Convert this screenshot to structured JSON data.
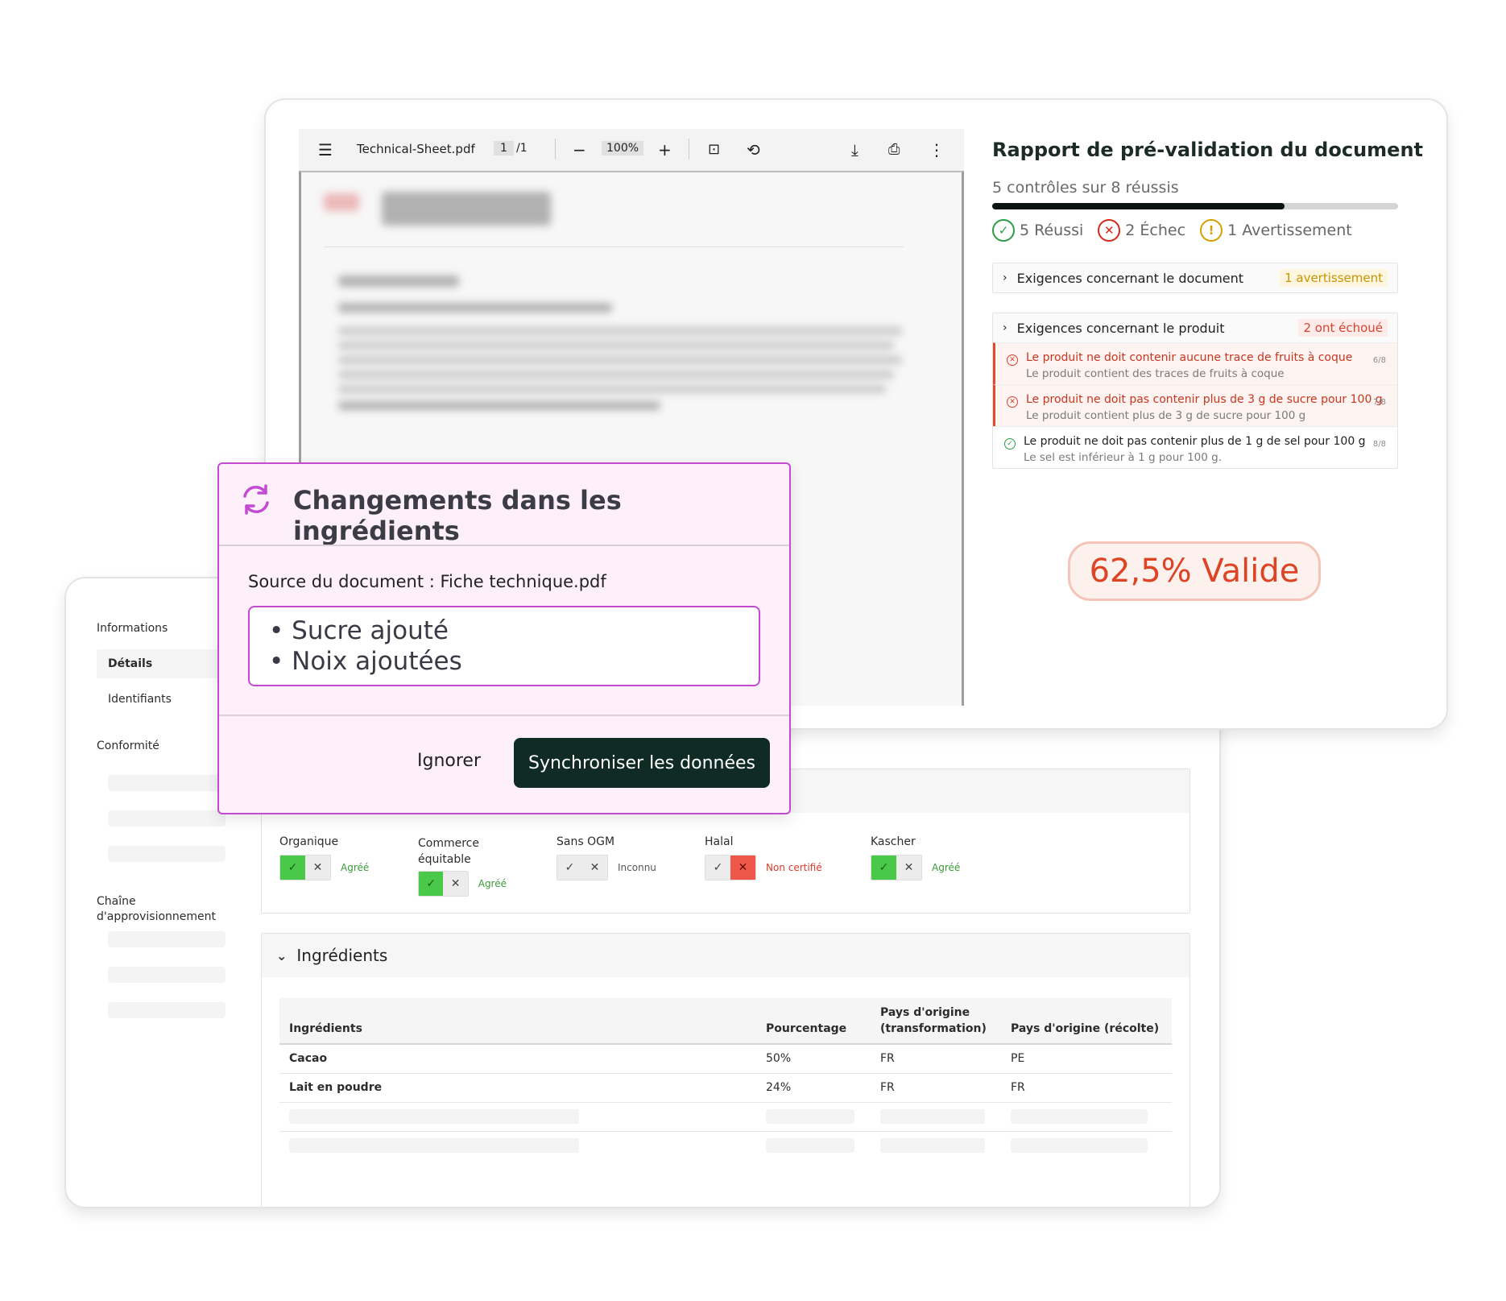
{
  "product_form": {
    "nav": {
      "section_info": "Informations",
      "item_details": "Détails",
      "item_ids": "Identifiants",
      "section_compliance": "Conformité",
      "section_supply": "Chaîne d'approvisionnement"
    },
    "certifications": [
      {
        "label": "Organique",
        "state": "yes",
        "status": "Agréé"
      },
      {
        "label": "Commerce équitable",
        "state": "yes",
        "status": "Agréé"
      },
      {
        "label": "Sans OGM",
        "state": "none",
        "status": "Inconnu"
      },
      {
        "label": "Halal",
        "state": "no",
        "status": "Non certifié"
      },
      {
        "label": "Kascher",
        "state": "yes",
        "status": "Agréé"
      }
    ],
    "ingredients_section": {
      "title": "Ingrédients",
      "columns": [
        "Ingrédients",
        "Pourcentage",
        "Pays d'origine (transformation)",
        "Pays d'origine (récolte)"
      ],
      "rows": [
        [
          "Cacao",
          "50%",
          "FR",
          "PE"
        ],
        [
          "Lait en poudre",
          "24%",
          "FR",
          "FR"
        ]
      ]
    }
  },
  "pdf_viewer": {
    "filename": "Technical-Sheet.pdf",
    "page_current": "1",
    "page_total": "/1",
    "zoom": "100%"
  },
  "report": {
    "title": "Rapport de pré-validation du document",
    "summary": "5 contrôles sur 8 réussis",
    "progress_fraction": 0.72,
    "passed": "5 Réussi",
    "failed": "2 Échec",
    "warning": "1 Avertissement",
    "doc_requirements": {
      "label": "Exigences concernant le document",
      "badge": "1 avertissement"
    },
    "product_requirements": {
      "label": "Exigences concernant le produit",
      "badge": "2 ont échoué",
      "items": [
        {
          "result": "fail",
          "title": "Le produit ne doit contenir aucune trace de fruits à coque",
          "detail": "Le produit contient des traces de fruits à coque",
          "index": "6/8"
        },
        {
          "result": "fail",
          "title": "Le produit ne doit pas contenir plus de 3 g de sucre pour 100 g",
          "detail": "Le produit contient plus de 3 g de sucre pour 100 g",
          "index": "7/8"
        },
        {
          "result": "pass",
          "title": "Le produit ne doit pas contenir plus de 1 g de sel pour 100 g",
          "detail": "Le sel est inférieur à 1 g pour 100 g.",
          "index": "8/8"
        }
      ]
    },
    "score": "62,5% Valide"
  },
  "modal": {
    "title": "Changements dans les ingrédients",
    "source": "Source du document : Fiche technique.pdf",
    "changes": [
      "Sucre ajouté",
      "Noix ajoutées"
    ],
    "ignore_label": "Ignorer",
    "sync_label": "Synchroniser les données"
  },
  "colors": {
    "accent_dark": "#0f2b24",
    "modal_accent": "#c34bd1",
    "success": "#2a9d47",
    "error": "#d32a1c",
    "warning": "#d4a000"
  }
}
